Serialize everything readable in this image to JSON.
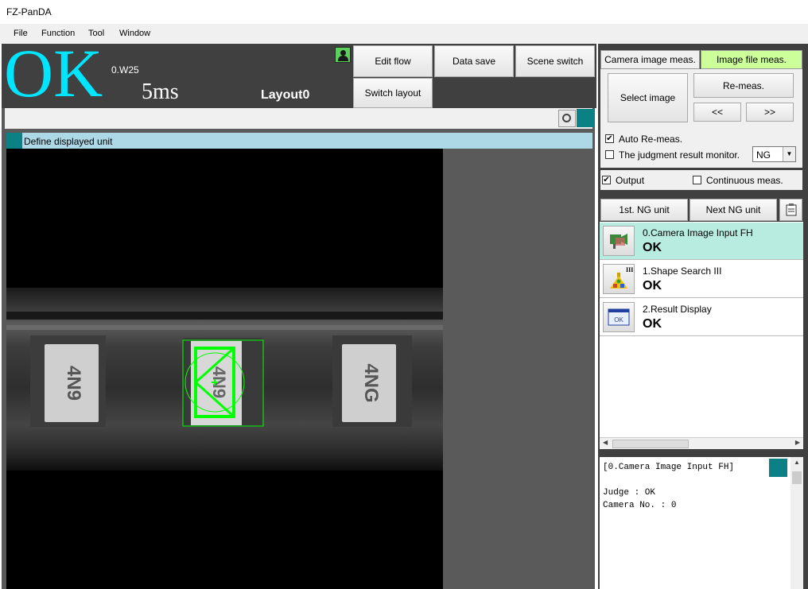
{
  "window": {
    "title": "FZ-PanDA"
  },
  "menu": [
    "File",
    "Function",
    "Tool",
    "Window"
  ],
  "status": {
    "judgement": "OK",
    "scene": "0.W25",
    "time": "5ms",
    "layout": "Layout0"
  },
  "toolbar": {
    "edit_flow": "Edit flow",
    "data_save": "Data save",
    "scene_switch": "Scene switch",
    "switch_layout": "Switch layout"
  },
  "image_window": {
    "unit_label": "Define displayed unit"
  },
  "meas": {
    "tab_camera": "Camera image meas.",
    "tab_file": "Image file meas.",
    "select_image": "Select image",
    "re_meas": "Re-meas.",
    "prev": "<<",
    "next": ">>",
    "auto_remeas": "Auto Re-meas.",
    "auto_remeas_checked": true,
    "judgment_monitor": "The judgment result monitor.",
    "judgment_monitor_checked": false,
    "judgment_value": "NG",
    "output": "Output",
    "output_checked": true,
    "continuous": "Continuous meas.",
    "continuous_checked": false
  },
  "ng": {
    "first": "1st. NG unit",
    "next": "Next NG unit"
  },
  "flow": [
    {
      "name": "0.Camera Image Input FH",
      "result": "OK",
      "icon": "camera-input-icon"
    },
    {
      "name": "1.Shape Search III",
      "result": "OK",
      "icon": "shape-search-icon"
    },
    {
      "name": "2.Result Display",
      "result": "OK",
      "icon": "result-display-icon"
    }
  ],
  "detail": {
    "heading": "[0.Camera Image Input FH]",
    "judge": "Judge : OK",
    "camera": "Camera No. : 0"
  },
  "colors": {
    "ok": "#00e5ff",
    "selected_row": "#b9ece0",
    "active_tab": "#ccff99",
    "teal": "#0b8085",
    "header_bg": "#404040",
    "roi": "#00ff00"
  },
  "camera_image": {
    "left_chip_text": "4N9",
    "center_chip_text": "4N9",
    "right_chip_text": "4NG"
  }
}
